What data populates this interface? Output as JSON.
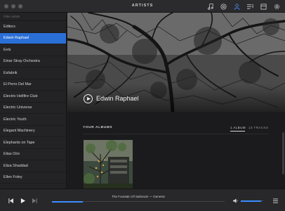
{
  "window": {
    "title": "ARTISTS"
  },
  "toolbar": {
    "buttons": [
      {
        "name": "music-note-icon"
      },
      {
        "name": "radio-icon"
      },
      {
        "name": "artist-icon",
        "active": true
      },
      {
        "name": "playlist-icon"
      },
      {
        "name": "album-icon"
      },
      {
        "name": "settings-icon"
      }
    ]
  },
  "sidebar": {
    "filter_placeholder": "Filter artists",
    "artists": [
      "Editors",
      "Edwin Raphael",
      "Eels",
      "Einar Stray Orchestra",
      "Esfabrik",
      "El Perro Del Mar",
      "Electric Hellfire Club",
      "Electric Universe",
      "Electric Youth",
      "Elegant Machinery",
      "Elephants on Tape",
      "Elias Orix",
      "Eliza Shaddad",
      "Ellen Foley"
    ],
    "selected_index": 1
  },
  "artist": {
    "name": "Edwin Raphael"
  },
  "albums": {
    "title": "YOUR ALBUMS",
    "album_count": "1 ALBUM",
    "track_count": "13 TRACKS"
  },
  "player": {
    "now_playing": "The Fountain Of Salmacis — Genesis",
    "progress": 0.18,
    "volume": 0.9
  },
  "colors": {
    "accent": "#2a6fd6",
    "progress": "#3a8cff"
  }
}
